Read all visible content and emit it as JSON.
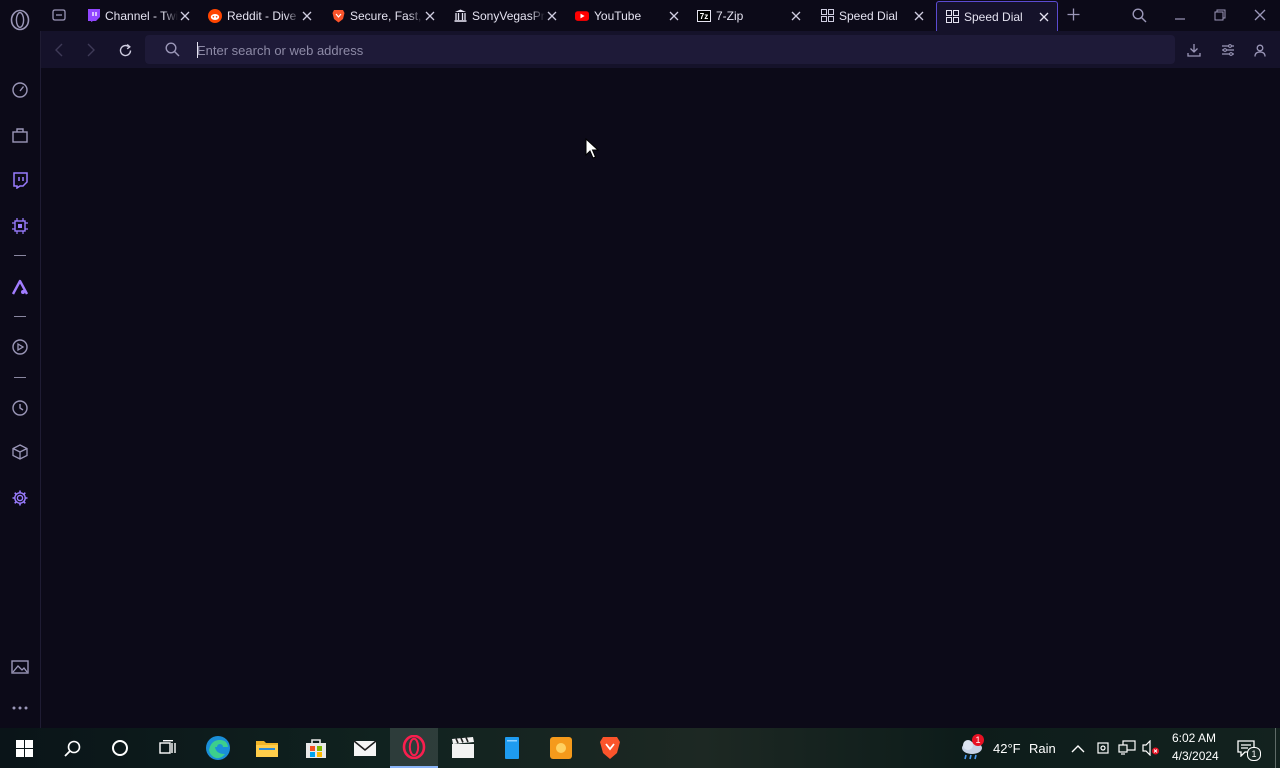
{
  "browser": {
    "tabs": [
      {
        "title": "Channel - Twitch",
        "icon": "twitch-icon",
        "active": false
      },
      {
        "title": "Reddit - Dive into anything",
        "icon": "reddit-icon",
        "active": false
      },
      {
        "title": "Secure, Fast, Private Browser",
        "icon": "brave-icon",
        "active": false
      },
      {
        "title": "SonyVegasPro",
        "icon": "archive-icon",
        "active": false
      },
      {
        "title": "YouTube",
        "icon": "youtube-icon",
        "active": false
      },
      {
        "title": "7-Zip",
        "icon": "7zip-icon",
        "active": false
      },
      {
        "title": "Speed Dial",
        "icon": "speed-dial-icon",
        "active": false
      },
      {
        "title": "Speed Dial",
        "icon": "speed-dial-icon",
        "active": true
      }
    ],
    "address_bar": {
      "value": "",
      "placeholder": "Enter search or web address"
    }
  },
  "sidebar": {
    "items": [
      "opera-logo",
      "speed-dial-icon",
      "store-icon",
      "twitch-icon",
      "hardware-icon",
      "music-icon",
      "player-icon",
      "history-icon",
      "extensions-icon",
      "settings-icon",
      "wallpaper-icon",
      "more-icon"
    ]
  },
  "taskbar": {
    "apps": [
      "windows-start-icon",
      "search-icon",
      "cortana-icon",
      "task-view-icon",
      "edge-icon",
      "file-explorer-icon",
      "store-icon",
      "mail-icon",
      "opera-gx-icon",
      "video-editor-icon",
      "notepad-icon",
      "media-app-icon",
      "brave-icon"
    ],
    "weather": {
      "temp": "42°F",
      "condition": "Rain",
      "alert_count": "1"
    },
    "clock": {
      "time": "6:02 AM",
      "date": "4/3/2024"
    },
    "notifications_count": "1"
  },
  "colors": {
    "accent": "#7b6cf6",
    "background": "#0c0a18",
    "active_tab_border": "#5b4bd1"
  }
}
